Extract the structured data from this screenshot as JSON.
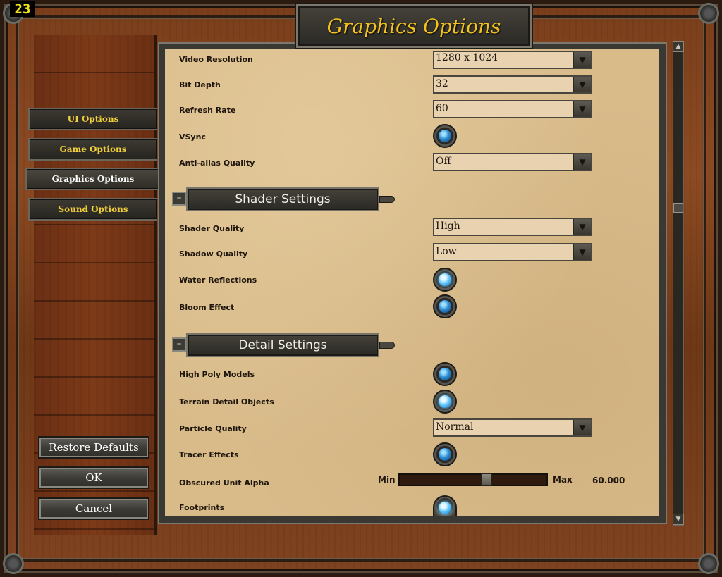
{
  "fps_counter": "23",
  "title": "Graphics Options",
  "nav": {
    "items": [
      {
        "label": "UI Options"
      },
      {
        "label": "Game Options"
      },
      {
        "label": "Graphics Options"
      },
      {
        "label": "Sound Options"
      }
    ],
    "active": "Graphics Options"
  },
  "actions": {
    "restore_defaults": "Restore Defaults",
    "ok": "OK",
    "cancel": "Cancel"
  },
  "settings": {
    "video_resolution": {
      "label": "Video Resolution",
      "value": "1280 x 1024"
    },
    "bit_depth": {
      "label": "Bit Depth",
      "value": "32"
    },
    "refresh_rate": {
      "label": "Refresh Rate",
      "value": "60"
    },
    "vsync": {
      "label": "VSync",
      "state": "off"
    },
    "anti_alias": {
      "label": "Anti-alias Quality",
      "value": "Off"
    }
  },
  "shader_section": {
    "title": "Shader Settings",
    "collapse_symbol": "–",
    "shader_quality": {
      "label": "Shader Quality",
      "value": "High"
    },
    "shadow_quality": {
      "label": "Shadow Quality",
      "value": "Low"
    },
    "water_reflections": {
      "label": "Water Reflections",
      "state": "on"
    },
    "bloom_effect": {
      "label": "Bloom Effect",
      "state": "off"
    }
  },
  "detail_section": {
    "title": "Detail Settings",
    "collapse_symbol": "–",
    "high_poly_models": {
      "label": "High Poly Models",
      "state": "off"
    },
    "terrain_detail_objects": {
      "label": "Terrain Detail Objects",
      "state": "on"
    },
    "particle_quality": {
      "label": "Particle Quality",
      "value": "Normal"
    },
    "tracer_effects": {
      "label": "Tracer Effects",
      "state": "off"
    },
    "obscured_unit_alpha": {
      "label": "Obscured Unit Alpha",
      "min_label": "Min",
      "max_label": "Max",
      "value": "60.000",
      "fraction": 0.6
    },
    "footprints": {
      "label": "Footprints",
      "state": "on"
    }
  },
  "icons": {
    "dropdown_arrow": "chevron-down-icon",
    "scroll_up": "arrow-up-icon",
    "scroll_down": "arrow-down-icon"
  },
  "colors": {
    "title_gold": "#f4c21f",
    "nav_gold": "#f0cf3c",
    "parchment": "#d9bb8a",
    "toggle_blue": "#2e8ed4"
  }
}
